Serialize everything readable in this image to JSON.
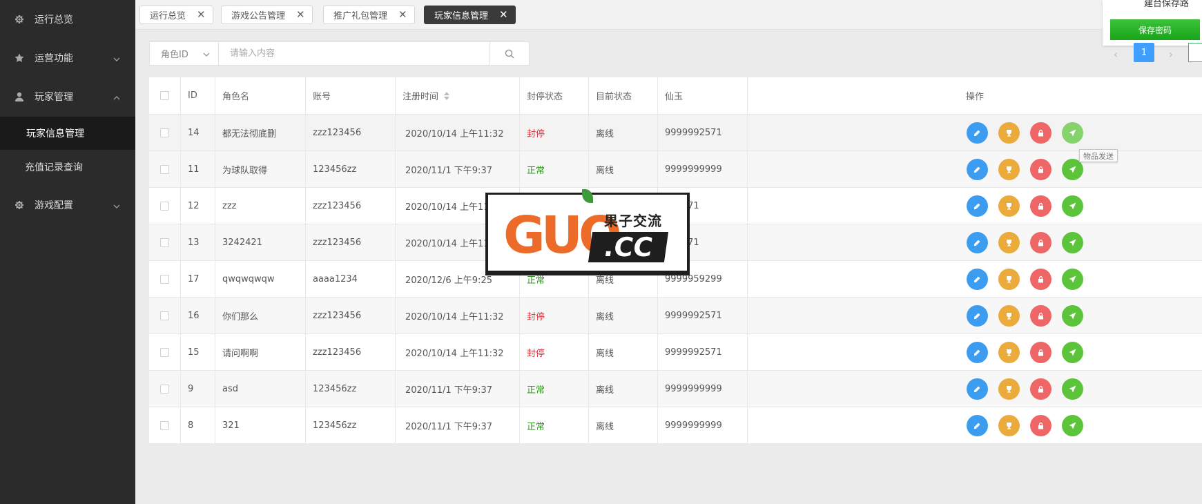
{
  "sidebar": {
    "items": [
      {
        "label": "运行总览",
        "icon": "gear-icon"
      },
      {
        "label": "运营功能",
        "icon": "star-icon"
      },
      {
        "label": "玩家管理",
        "icon": "user-icon"
      },
      {
        "label": "游戏配置",
        "icon": "gear-icon"
      }
    ],
    "sub": [
      {
        "label": "玩家信息管理"
      },
      {
        "label": "充值记录查询"
      }
    ]
  },
  "tabs": [
    {
      "label": "运行总览"
    },
    {
      "label": "游戏公告管理"
    },
    {
      "label": "推广礼包管理"
    },
    {
      "label": "玩家信息管理"
    }
  ],
  "save": {
    "top_text": "建台保存路",
    "button": "保存密码"
  },
  "search": {
    "field": "角色ID",
    "placeholder": "请输入内容"
  },
  "pagination": {
    "current": "1",
    "prev": "‹",
    "next": "›"
  },
  "table": {
    "headers": [
      "ID",
      "角色名",
      "账号",
      "注册时间",
      "封停状态",
      "目前状态",
      "仙玉",
      "操作"
    ],
    "rows": [
      {
        "id": "14",
        "name": "都无法彻底删",
        "account": "zzz123456",
        "time": "2020/10/14 上午11:32",
        "ban": "封停",
        "status": "离线",
        "xianyu": "9999992571"
      },
      {
        "id": "11",
        "name": "为球队取得",
        "account": "123456zz",
        "time": "2020/11/1 下午9:37",
        "ban": "正常",
        "status": "离线",
        "xianyu": "9999999999"
      },
      {
        "id": "12",
        "name": "zzz",
        "account": "zzz123456",
        "time": "2020/10/14 上午11",
        "ban": "",
        "status": "",
        "xianyu": "992571"
      },
      {
        "id": "13",
        "name": "3242421",
        "account": "zzz123456",
        "time": "2020/10/14 上午11",
        "ban": "",
        "status": "",
        "xianyu": "992571"
      },
      {
        "id": "17",
        "name": "qwqwqwqw",
        "account": "aaaa1234",
        "time": "2020/12/6 上午9:25",
        "ban": "正常",
        "status": "离线",
        "xianyu": "9999959299"
      },
      {
        "id": "16",
        "name": "你们那么",
        "account": "zzz123456",
        "time": "2020/10/14 上午11:32",
        "ban": "封停",
        "status": "离线",
        "xianyu": "9999992571"
      },
      {
        "id": "15",
        "name": "请问啊啊",
        "account": "zzz123456",
        "time": "2020/10/14 上午11:32",
        "ban": "封停",
        "status": "离线",
        "xianyu": "9999992571"
      },
      {
        "id": "9",
        "name": "asd",
        "account": "123456zz",
        "time": "2020/11/1 下午9:37",
        "ban": "正常",
        "status": "离线",
        "xianyu": "9999999999"
      },
      {
        "id": "8",
        "name": "321",
        "account": "123456zz",
        "time": "2020/11/1 下午9:37",
        "ban": "正常",
        "status": "离线",
        "xianyu": "9999999999"
      }
    ],
    "actions": [
      "edit-icon",
      "trophy-icon",
      "lock-icon",
      "send-icon"
    ]
  },
  "tooltip": "物品发送",
  "watermark": {
    "brand": "GUO",
    "cn": "果子交流",
    "domain": ".CC"
  },
  "colors": {
    "primary": "#409eff",
    "ban": "#d9363e",
    "ok": "#2e9a1b",
    "save": "#1aad19"
  }
}
